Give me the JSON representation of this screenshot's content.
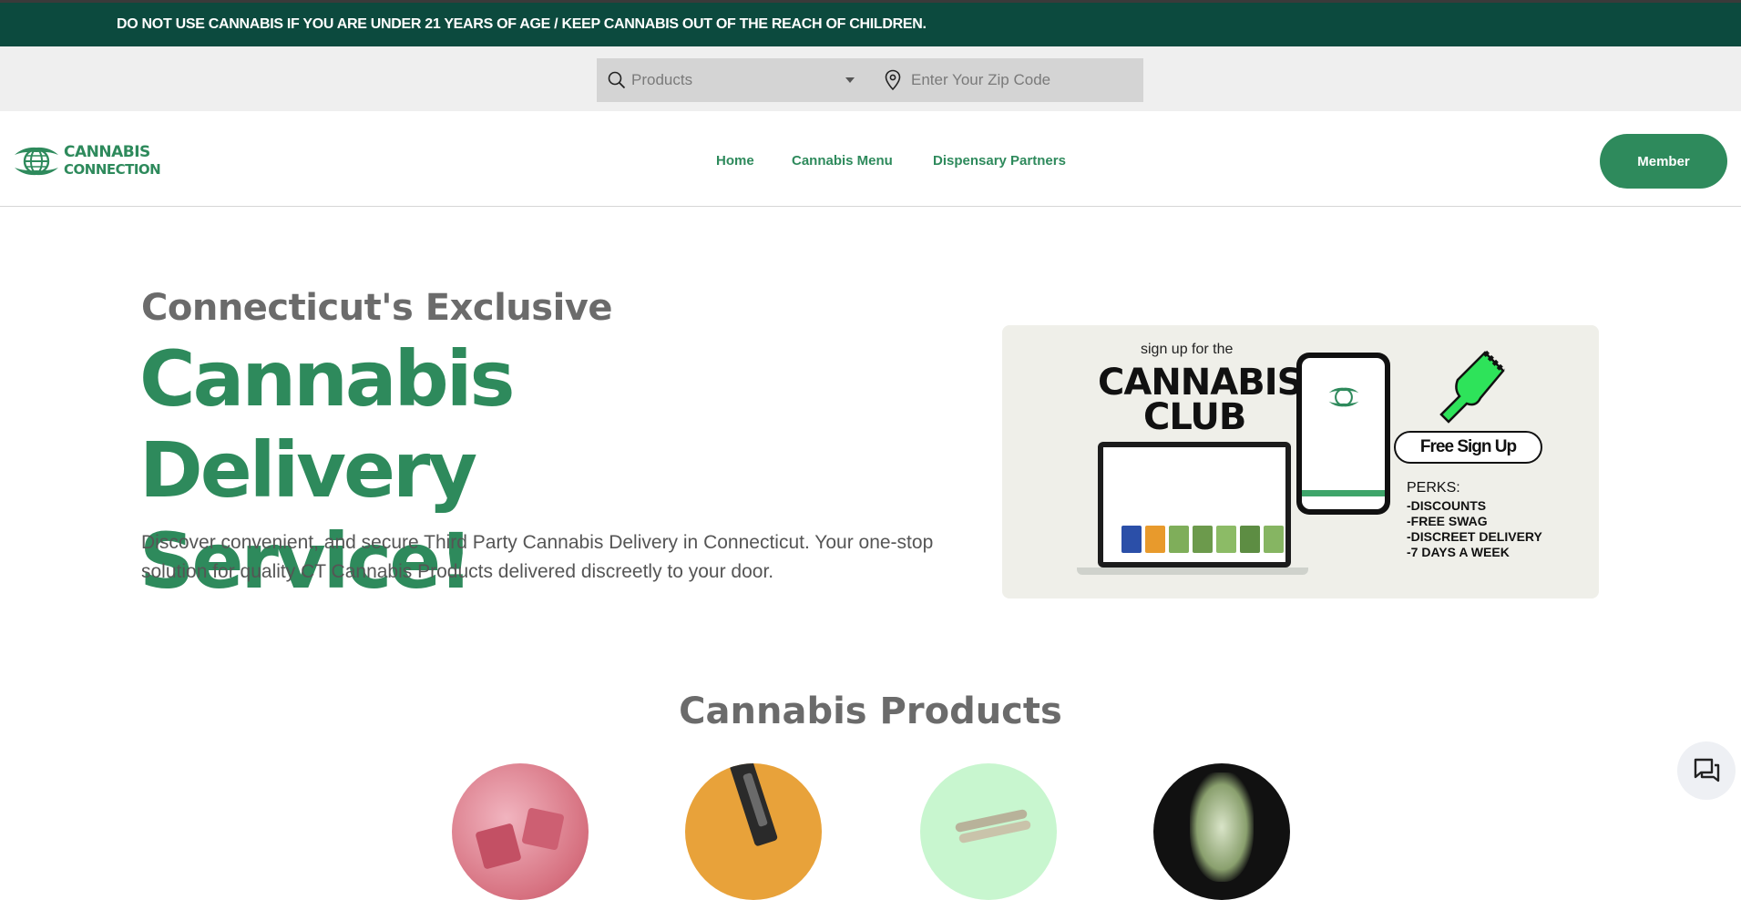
{
  "banner": {
    "text": "DO NOT USE CANNABIS IF YOU ARE UNDER 21 YEARS OF AGE / KEEP CANNABIS OUT OF THE REACH OF CHILDREN."
  },
  "search": {
    "category_selected": "Products",
    "zip_placeholder": "Enter Your Zip Code"
  },
  "logo": {
    "line1": "CANNABIS",
    "line2": "CONNECTION"
  },
  "nav": {
    "items": [
      "Home",
      "Cannabis Menu",
      "Dispensary Partners"
    ]
  },
  "member_button": "Member",
  "hero": {
    "pre_title": "Connecticut's Exclusive",
    "title": "Cannabis Delivery Service!",
    "description": "Discover convenient, and secure Third Party Cannabis Delivery in Connecticut. Your one-stop solution for quality CT Cannabis Products delivered discreetly to your door."
  },
  "promo": {
    "sign_up": "sign up for the",
    "club_line1": "CANNABIS",
    "club_line2": "CLUB",
    "free_signup": "Free Sign Up",
    "perks_title": "PERKS:",
    "perks": [
      "-DISCOUNTS",
      "-FREE SWAG",
      "-DISCREET DELIVERY",
      "-7 DAYS A WEEK"
    ]
  },
  "products_section": {
    "title": "Cannabis Products"
  },
  "colors": {
    "brand_green": "#2e8a5c",
    "banner_bg": "#0c4a3e"
  },
  "icons": [
    "search-icon",
    "chevron-down-icon",
    "location-pin-icon",
    "globe-logo-icon",
    "chat-icon"
  ]
}
